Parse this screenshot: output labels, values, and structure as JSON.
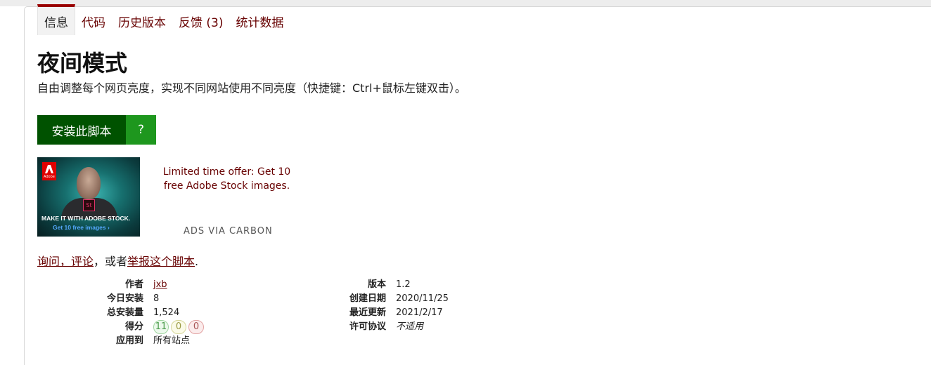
{
  "tabs": [
    {
      "label": "信息",
      "active": true
    },
    {
      "label": "代码",
      "active": false
    },
    {
      "label": "历史版本",
      "active": false
    },
    {
      "label": "反馈 (3)",
      "active": false
    },
    {
      "label": "统计数据",
      "active": false
    }
  ],
  "script": {
    "title": "夜间模式",
    "description": "自由调整每个网页亮度，实现不同网站使用不同亮度（快捷键：Ctrl+鼠标左键双击）。",
    "install_label": "安装此脚本",
    "help_label": "?"
  },
  "ad": {
    "image_line1": "MAKE IT WITH ADOBE STOCK.",
    "image_line2": "Get 10 free images ›",
    "logo_text": "Adobe",
    "badge_text": "St",
    "text": "Limited time offer: Get 10 free Adobe Stock images.",
    "via": "ADS VIA CARBON"
  },
  "feedback": {
    "ask_link": "询问，评论",
    "middle": "，或者",
    "report_link": "举报这个脚本",
    "end": "."
  },
  "meta_left": {
    "author_label": "作者",
    "author_value": "jxb",
    "today_label": "今日安装",
    "today_value": "8",
    "total_label": "总安装量",
    "total_value": "1,524",
    "score_label": "得分",
    "score_good": "11",
    "score_ok": "0",
    "score_bad": "0",
    "applies_label": "应用到",
    "applies_value": "所有站点"
  },
  "meta_right": {
    "version_label": "版本",
    "version_value": "1.2",
    "created_label": "创建日期",
    "created_value": "2020/11/25",
    "updated_label": "最近更新",
    "updated_value": "2021/2/17",
    "license_label": "许可协议",
    "license_value": "不适用"
  },
  "colors": {
    "accent": "#990000",
    "link": "#670000",
    "install_button": "#005200",
    "help_button": "#1e971e"
  }
}
